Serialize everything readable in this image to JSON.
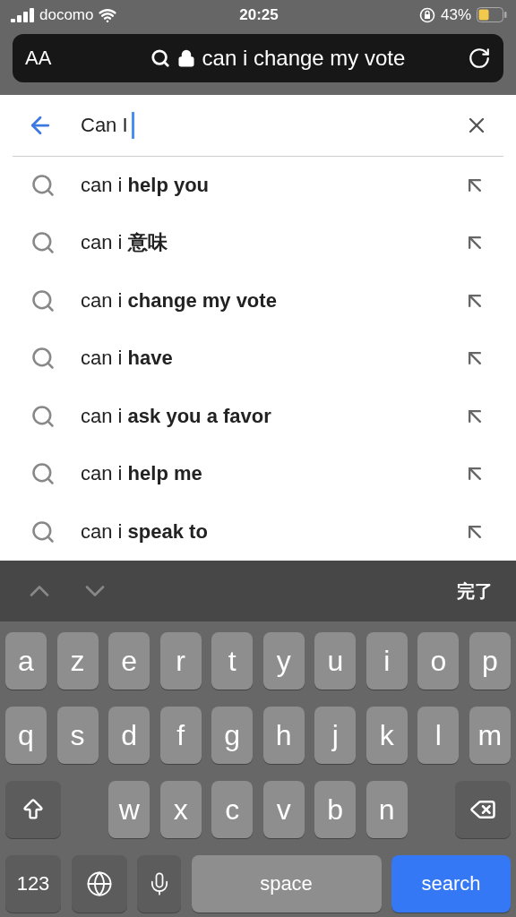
{
  "status_bar": {
    "carrier": "docomo",
    "time": "20:25",
    "battery": "43%"
  },
  "address_bar": {
    "text_size": "AA",
    "query": "can i change my vote"
  },
  "search": {
    "value": "Can I"
  },
  "suggestions": [
    {
      "text": "can i **help you**"
    },
    {
      "text": "can i **意味**"
    },
    {
      "text": "can i **change my vote**"
    },
    {
      "text": "can i **have**"
    },
    {
      "text": "can i **ask you a favor**"
    },
    {
      "text": "can i **help me**"
    },
    {
      "text": "can i **speak to**"
    }
  ],
  "keyboard": {
    "done": "完了",
    "rows": [
      {
        "keys": [
          {
            "kind": "letter",
            "label": "a"
          },
          {
            "kind": "letter",
            "label": "z"
          },
          {
            "kind": "letter",
            "label": "e"
          },
          {
            "kind": "letter",
            "label": "r"
          },
          {
            "kind": "letter",
            "label": "t"
          },
          {
            "kind": "letter",
            "label": "y"
          },
          {
            "kind": "letter",
            "label": "u"
          },
          {
            "kind": "letter",
            "label": "i"
          },
          {
            "kind": "letter",
            "label": "o"
          },
          {
            "kind": "letter",
            "label": "p"
          }
        ]
      },
      {
        "keys": [
          {
            "kind": "letter",
            "label": "q"
          },
          {
            "kind": "letter",
            "label": "s"
          },
          {
            "kind": "letter",
            "label": "d"
          },
          {
            "kind": "letter",
            "label": "f"
          },
          {
            "kind": "letter",
            "label": "g"
          },
          {
            "kind": "letter",
            "label": "h"
          },
          {
            "kind": "letter",
            "label": "j"
          },
          {
            "kind": "letter",
            "label": "k"
          },
          {
            "kind": "letter",
            "label": "l"
          },
          {
            "kind": "letter",
            "label": "m"
          }
        ]
      },
      {
        "keys": [
          {
            "kind": "shift"
          },
          {
            "kind": "letter",
            "label": "w"
          },
          {
            "kind": "letter",
            "label": "x"
          },
          {
            "kind": "letter",
            "label": "c"
          },
          {
            "kind": "letter",
            "label": "v"
          },
          {
            "kind": "letter",
            "label": "b"
          },
          {
            "kind": "letter",
            "label": "n"
          },
          {
            "kind": "delete"
          }
        ]
      },
      {
        "keys": [
          {
            "kind": "numbers",
            "label": "123"
          },
          {
            "kind": "globe"
          },
          {
            "kind": "mic"
          },
          {
            "kind": "space",
            "label": "space"
          },
          {
            "kind": "search",
            "label": "search"
          }
        ]
      }
    ]
  }
}
